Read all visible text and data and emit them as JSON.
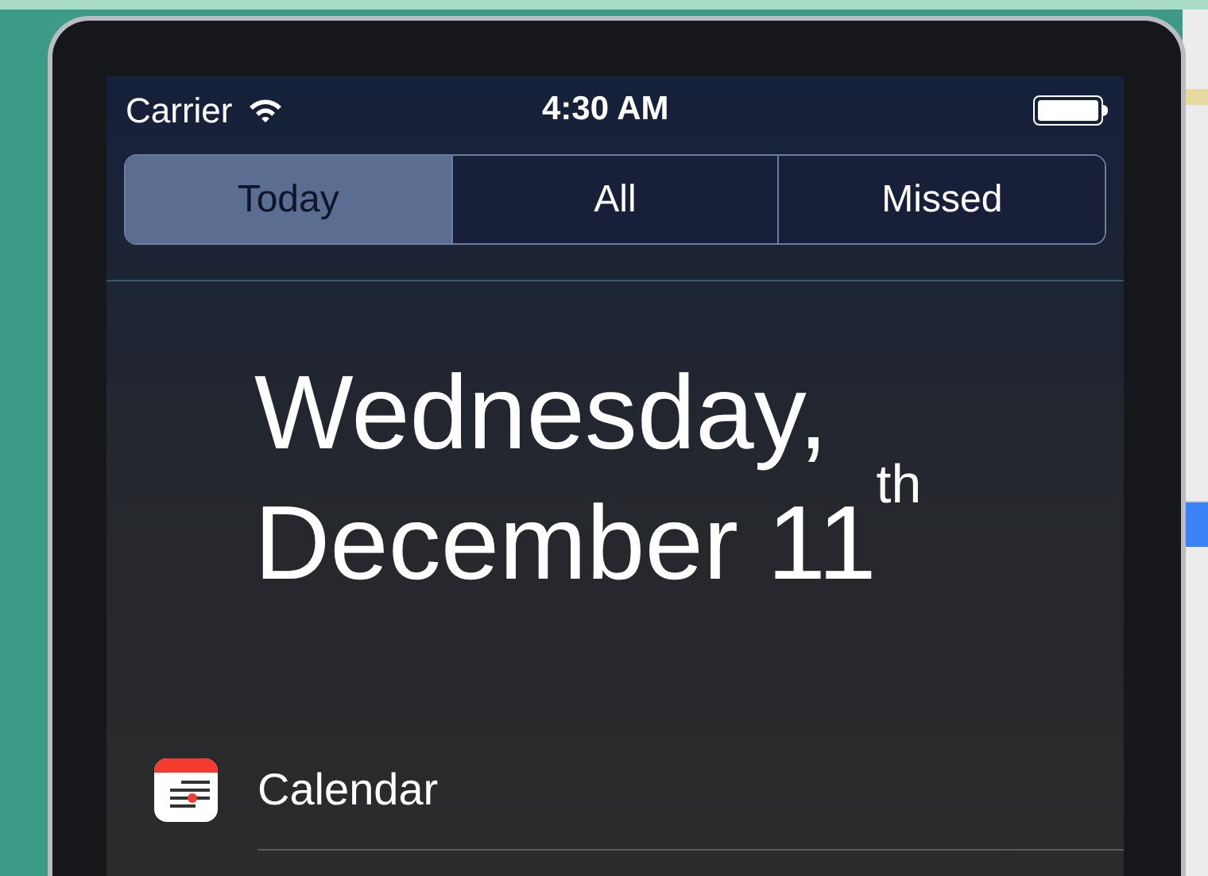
{
  "status_bar": {
    "carrier": "Carrier",
    "time": "4:30 AM"
  },
  "tabs": [
    {
      "label": "Today",
      "selected": true
    },
    {
      "label": "All",
      "selected": false
    },
    {
      "label": "Missed",
      "selected": false
    }
  ],
  "date": {
    "line_1": "Wednesday,",
    "line_2": "December 11$^{th}$"
  },
  "sections": [
    {
      "title": "Calendar"
    }
  ]
}
